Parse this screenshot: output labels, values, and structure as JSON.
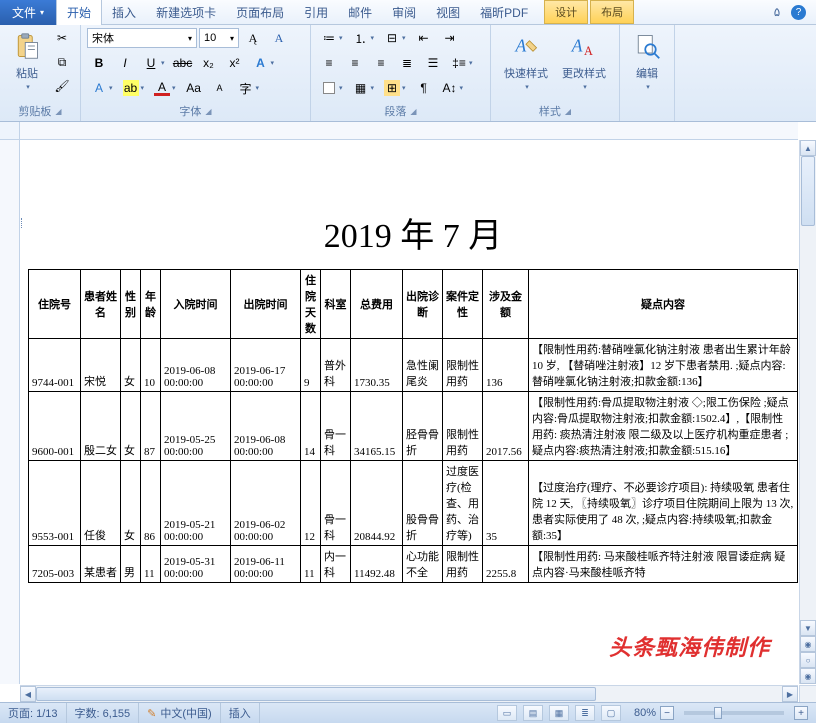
{
  "menu": {
    "file": "文件",
    "tabs": [
      "开始",
      "插入",
      "新建选项卡",
      "页面布局",
      "引用",
      "邮件",
      "审阅",
      "视图",
      "福昕PDF"
    ],
    "tool_tabs": [
      "设计",
      "布局"
    ]
  },
  "ribbon": {
    "clipboard": {
      "label": "剪贴板",
      "paste": "粘贴"
    },
    "font": {
      "label": "字体",
      "name": "宋体",
      "size": "10"
    },
    "paragraph": {
      "label": "段落"
    },
    "styles": {
      "label": "样式",
      "quick": "快速样式",
      "change": "更改样式"
    },
    "editing": {
      "label": "编辑"
    }
  },
  "doc": {
    "title": "2019 年 7 月",
    "headers": [
      "住院号",
      "患者姓名",
      "性别",
      "年龄",
      "入院时间",
      "出院时间",
      "住院天数",
      "科室",
      "总费用",
      "出院诊断",
      "案件定性",
      "涉及金额",
      "疑点内容"
    ],
    "rows": [
      {
        "c": [
          "9744-001",
          "宋悦",
          "女",
          "10",
          "2019-06-08 00:00:00",
          "2019-06-17 00:00:00",
          "9",
          "普外科",
          "1730.35",
          "急性阑尾炎",
          "限制性用药",
          "136",
          "【限制性用药:替硝唑氯化钠注射液 患者出生累计年龄 10 岁, 【替硝唑注射液】12 岁下患者禁用. ;疑点内容:替硝唑氯化钠注射液;扣款金额:136】"
        ]
      },
      {
        "c": [
          "9600-001",
          "殷二女",
          "女",
          "87",
          "2019-05-25 00:00:00",
          "2019-06-08 00:00:00",
          "14",
          "骨一科",
          "34165.15",
          "胫骨骨折",
          "限制性用药",
          "2017.56",
          "【限制性用药:骨瓜提取物注射液 ◇;限工伤保险 ;疑点内容:骨瓜提取物注射液;扣款金额:1502.4】,【限制性用药: 痰热清注射液 限二级及以上医疗机构重症患者 ;疑点内容:痰热清注射液;扣款金额:515.16】"
        ]
      },
      {
        "c": [
          "9553-001",
          "任俊",
          "女",
          "86",
          "2019-05-21 00:00:00",
          "2019-06-02 00:00:00",
          "12",
          "骨一科",
          "20844.92",
          "股骨骨折",
          "过度医疗(检查、用药、治疗等)",
          "35",
          "【过度治疗(理疗、不必要诊疗项目): 持续吸氧 患者住院 12 天, 〖持续吸氧〗诊疗项目住院期间上限为 13 次, 患者实际使用了 48 次, ;疑点内容:持续吸氧;扣款金额:35】"
        ]
      },
      {
        "c": [
          "7205-003",
          "某患者",
          "男",
          "11",
          "2019-05-31 00:00:00",
          "2019-06-11 00:00:00",
          "11",
          "内一科",
          "11492.48",
          "心功能不全",
          "限制性用药",
          "2255.8",
          "【限制性用药: 马来酸桂哌齐特注射液 限冒诿症病  疑点内容·马来酸桂哌齐特"
        ]
      }
    ],
    "watermark": "头条甄海伟制作"
  },
  "status": {
    "page": "页面: 1/13",
    "words": "字数: 6,155",
    "lang": "中文(中国)",
    "mode": "插入",
    "zoom": "80%"
  }
}
